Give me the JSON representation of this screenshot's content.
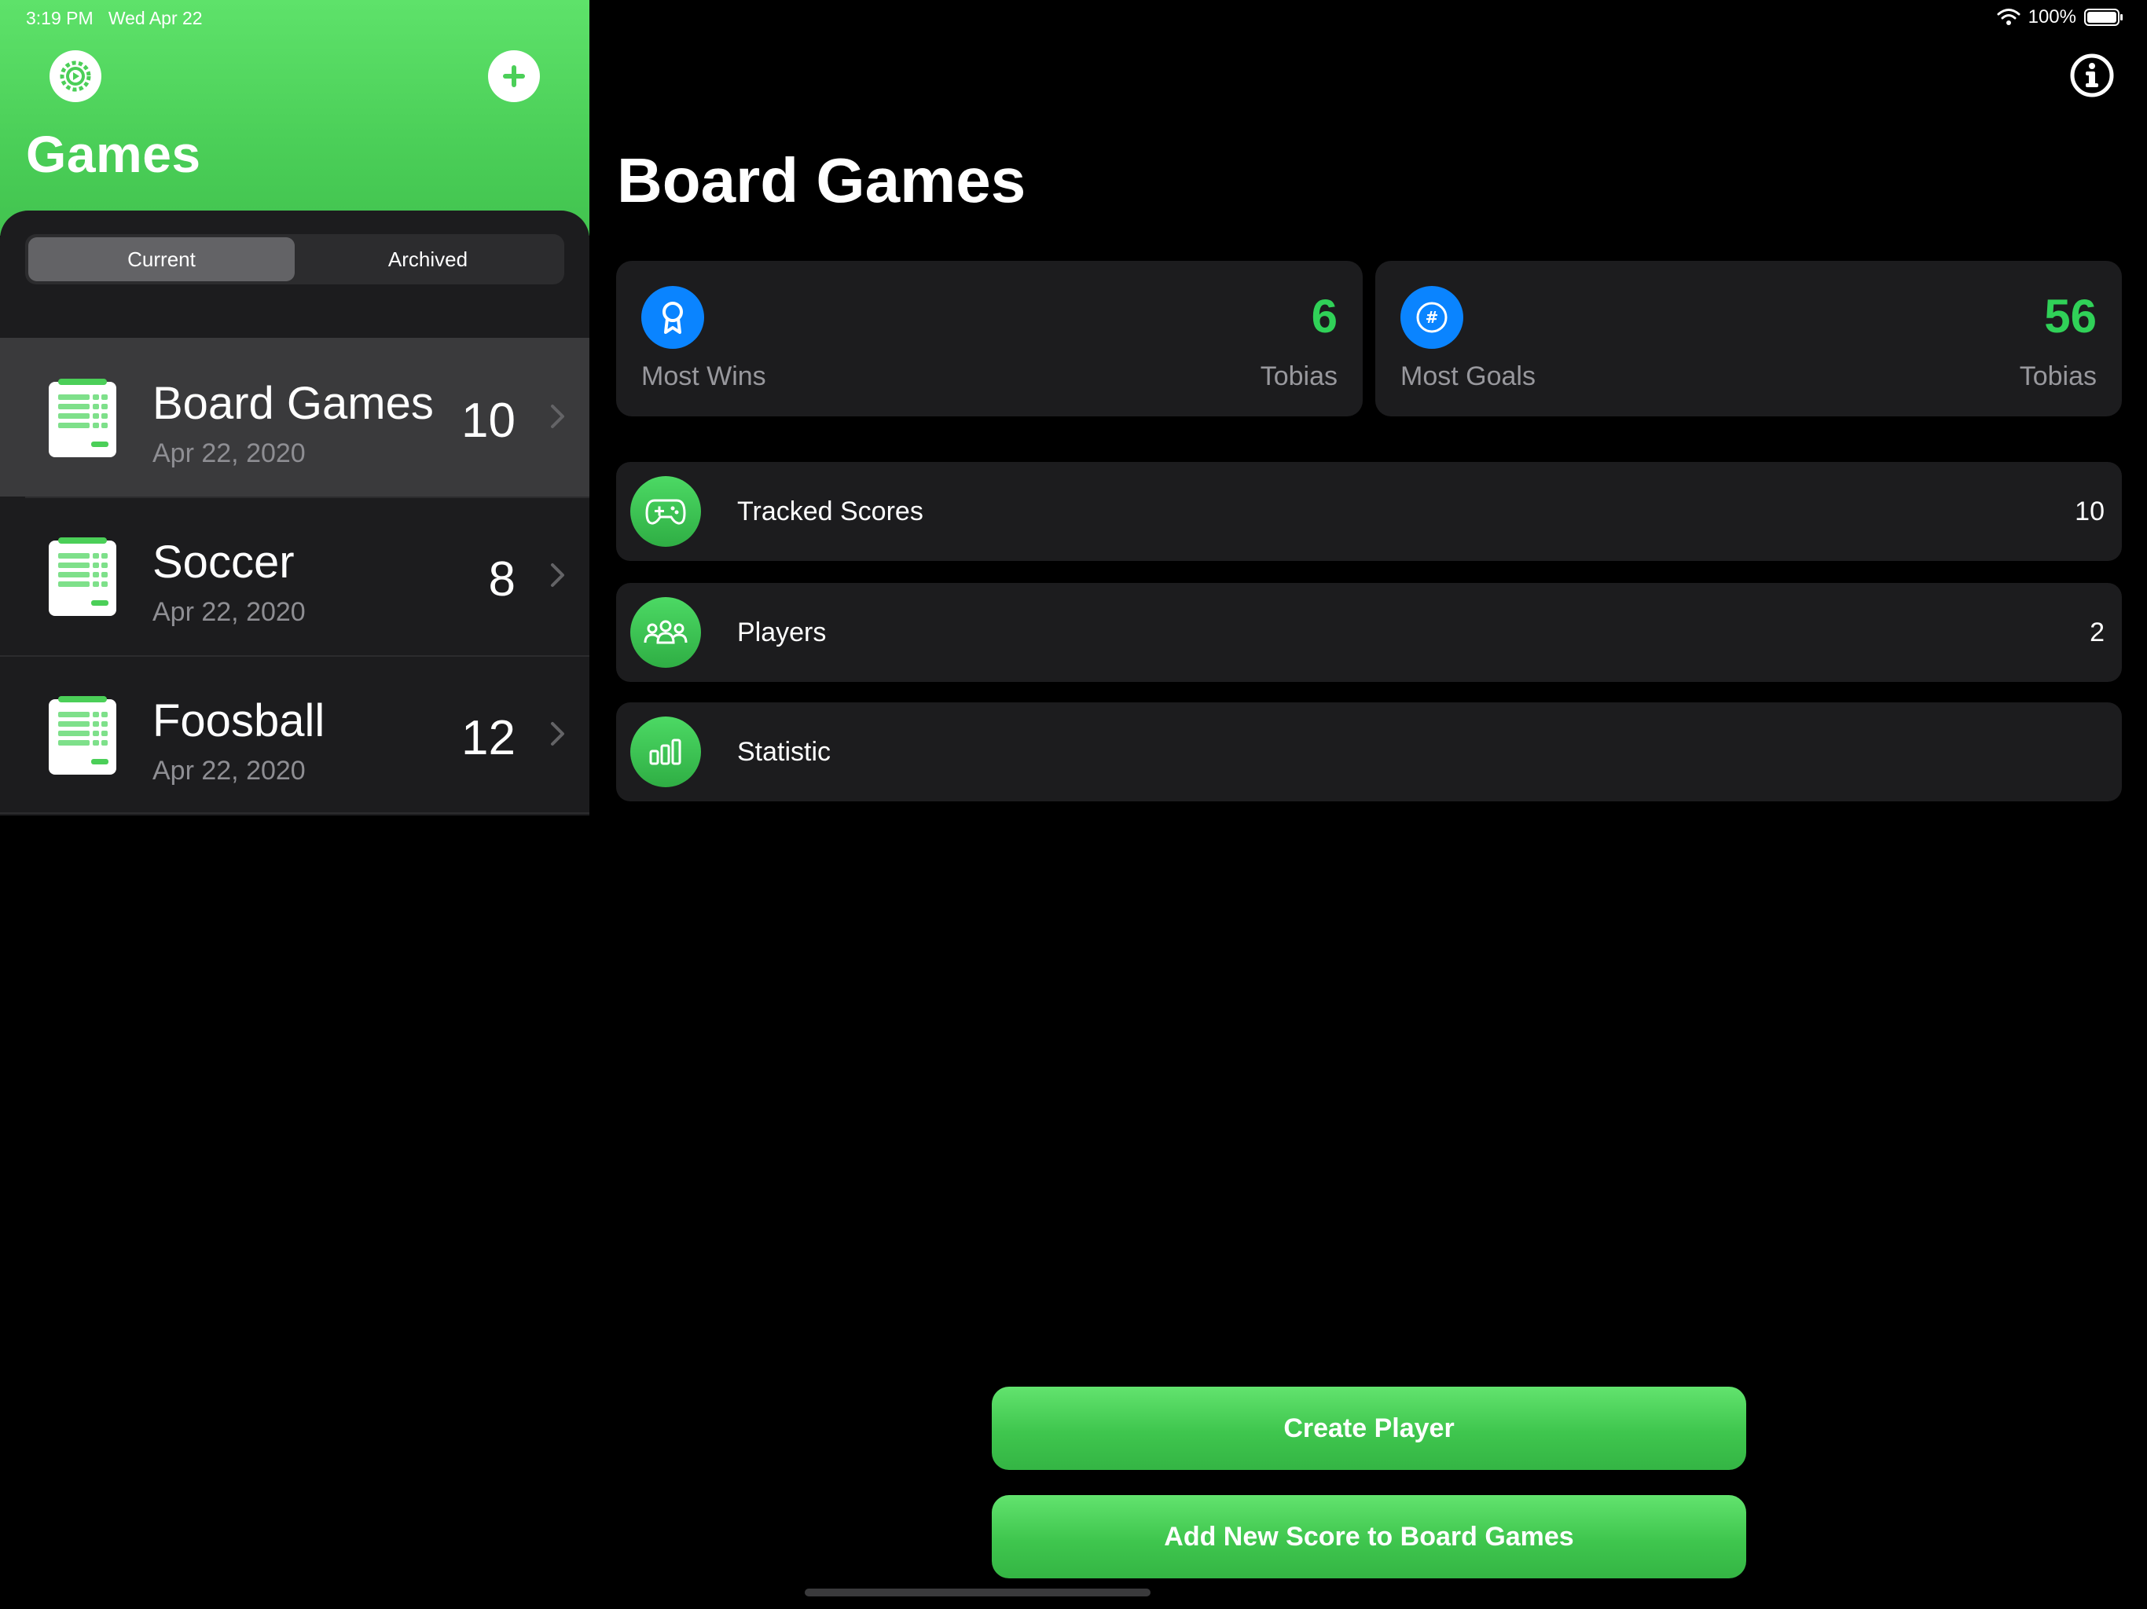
{
  "status_bar": {
    "time": "3:19 PM",
    "date": "Wed Apr 22",
    "battery": "100%"
  },
  "sidebar": {
    "title": "Games",
    "segments": [
      {
        "label": "Current",
        "active": true
      },
      {
        "label": "Archived",
        "active": false
      }
    ],
    "games": [
      {
        "name": "Board Games",
        "date": "Apr 22, 2020",
        "count": "10",
        "selected": true
      },
      {
        "name": "Soccer",
        "date": "Apr 22, 2020",
        "count": "8",
        "selected": false
      },
      {
        "name": "Foosball",
        "date": "Apr 22, 2020",
        "count": "12",
        "selected": false
      }
    ]
  },
  "main": {
    "title": "Board Games",
    "stats": [
      {
        "label": "Most Wins",
        "value": "6",
        "name": "Tobias",
        "icon": "award-icon"
      },
      {
        "label": "Most Goals",
        "value": "56",
        "name": "Tobias",
        "icon": "number-icon"
      }
    ],
    "menu": [
      {
        "label": "Tracked Scores",
        "count": "10",
        "icon": "gamecontroller-icon"
      },
      {
        "label": "Players",
        "count": "2",
        "icon": "people-icon"
      },
      {
        "label": "Statistic",
        "count": "",
        "icon": "bar-chart-icon"
      }
    ],
    "buttons": {
      "create_player": "Create Player",
      "add_score": "Add New Score to Board Games"
    }
  },
  "colors": {
    "accent_green": "#4bcf58",
    "value_green": "#30d158",
    "blue": "#0a84ff",
    "card_bg": "#1c1c1e"
  }
}
